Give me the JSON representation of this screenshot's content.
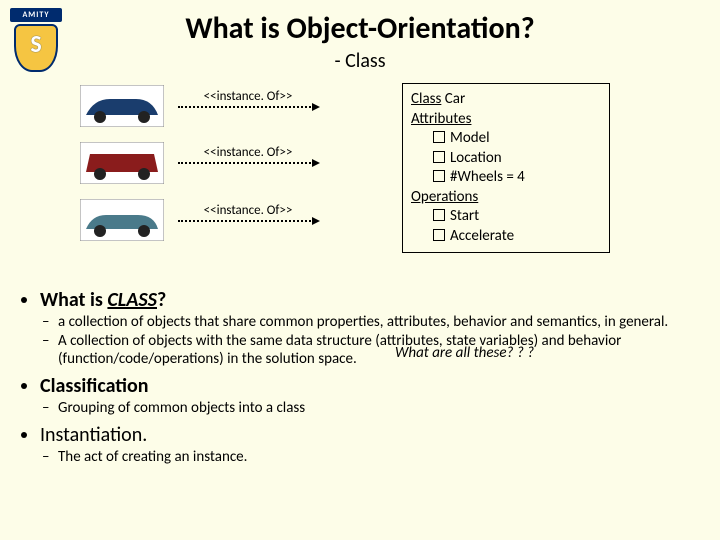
{
  "logo": {
    "text": "AMITY"
  },
  "title": "What is Object-Orientation?",
  "subtitle": "- Class",
  "instance_labels": {
    "a": "<<instance. Of>>",
    "b": "<<instance. Of>>",
    "c": "<<instance. Of>>"
  },
  "classbox": {
    "line_class": "Class",
    "line_class_val": "Car",
    "attrs_label": "Attributes",
    "attrs": {
      "a": "Model",
      "b": "Location",
      "c": "#Wheels = 4"
    },
    "ops_label": "Operations",
    "ops": {
      "a": "Start",
      "b": "Accelerate"
    }
  },
  "bullets": {
    "q_class": {
      "prefix": "What is ",
      "emph": "CLASS",
      "suffix": "?"
    },
    "class_def1": "a collection of objects that share common properties, attributes, behavior and semantics, in general.",
    "what_all": "What are all these? ? ?",
    "class_def2": "A collection of objects with the same data structure (attributes, state variables) and behavior (function/code/operations) in the solution space.",
    "classification": "Classification",
    "classification_def": "Grouping of common objects into a class",
    "instantiation": "Instantiation.",
    "instantiation_def": "The act of creating an instance."
  },
  "car_colors": {
    "a": "#1a3d6d",
    "b": "#8a1c1c",
    "c": "#4a7a8a"
  }
}
